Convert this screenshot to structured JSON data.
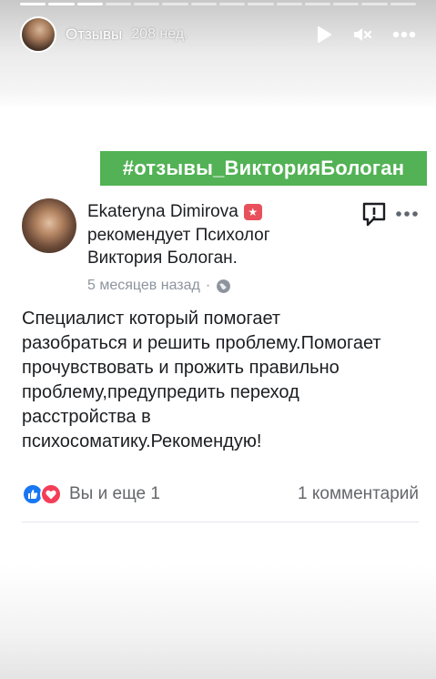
{
  "story": {
    "progress_segments": 14,
    "progress_done": 3,
    "header": {
      "title": "Отзывы",
      "time": "208 нед.",
      "icons": [
        "play-icon",
        "mute-icon",
        "more-icon"
      ]
    },
    "hashtag": "#отзывы_ВикторияБологан"
  },
  "post": {
    "author": "Ekateryna Dimirova",
    "recommends": "рекомендует Психолог Виктория Бологан.",
    "time": "5 месяцев назад",
    "dot": "·",
    "body": "Специалист который помогает разобраться и решить проблему.Помогает прочувствовать и прожить правильно проблему,предупредить переход расстройства в психосоматику.Рекомендую!",
    "reactions_text": "Вы и еще 1",
    "comments_text": "1 комментарий"
  },
  "colors": {
    "hashtag_bg": "#52b255",
    "like": "#1877f2",
    "love": "#f33e58",
    "recommend_badge": "#e8505b"
  }
}
